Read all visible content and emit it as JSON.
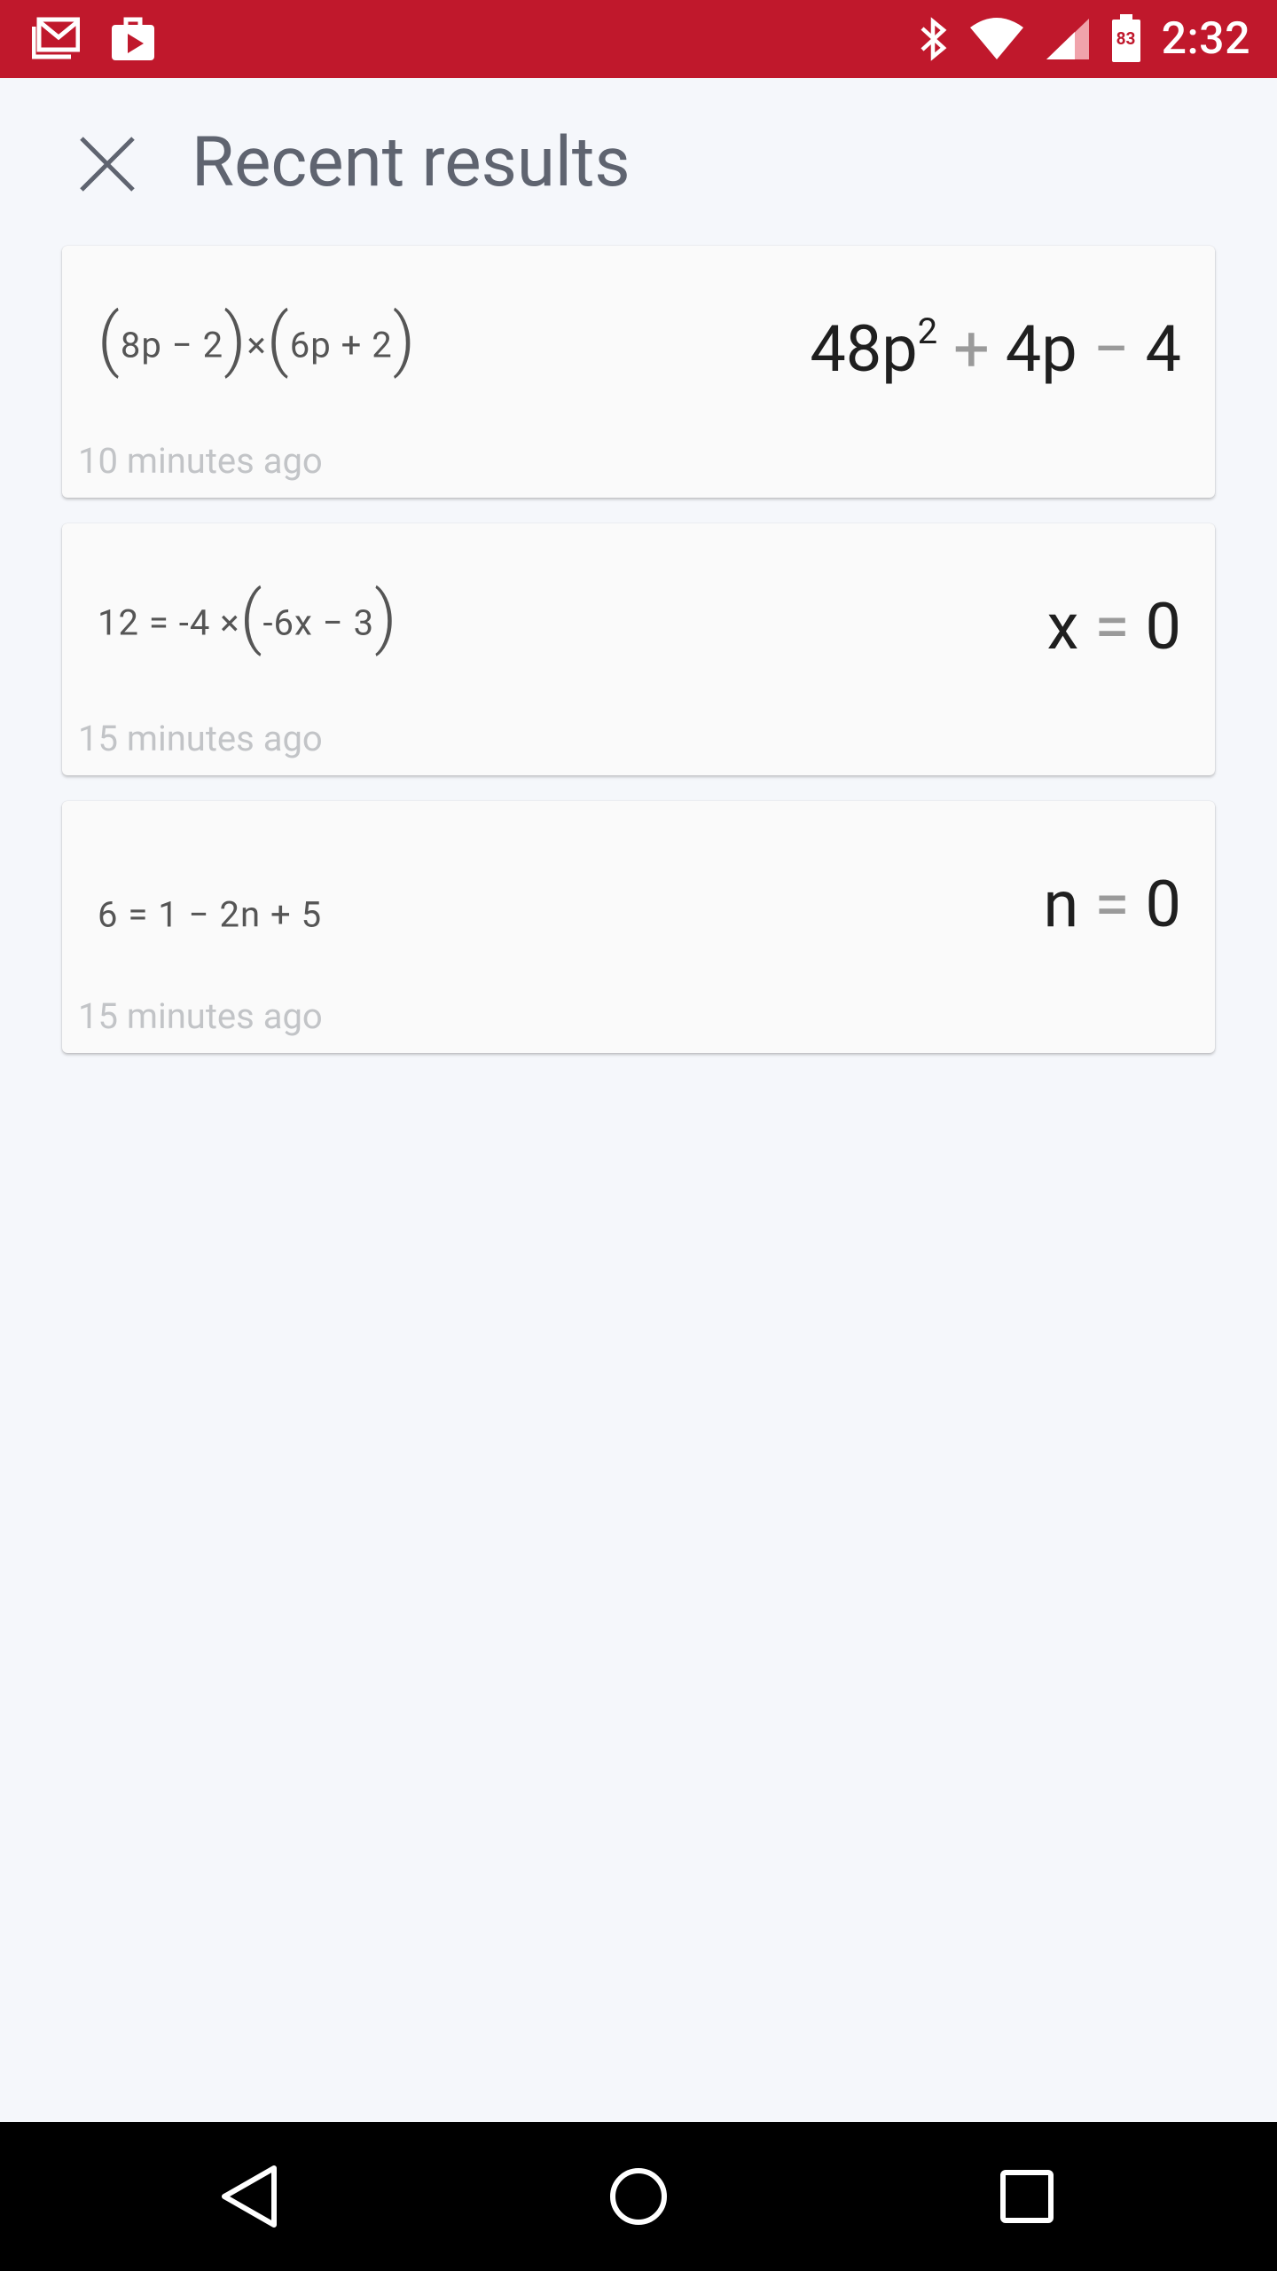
{
  "status_bar": {
    "time": "2:32",
    "battery_level": "83",
    "background_color": "#c0182c"
  },
  "header": {
    "title": "Recent results"
  },
  "results": [
    {
      "expression_parts": [
        "(",
        "8p − 2",
        ")",
        "×",
        "(",
        "6p + 2",
        ")"
      ],
      "answer_parts": [
        "48p",
        "2",
        "+",
        "4p",
        "−",
        "4"
      ],
      "timestamp": "10 minutes ago"
    },
    {
      "expression_parts": [
        "12 = -4 ×",
        "(",
        "-6x − 3",
        ")"
      ],
      "answer_parts": [
        "x",
        "=",
        "0"
      ],
      "timestamp": "15 minutes ago"
    },
    {
      "expression_parts": [
        "6 = 1 − 2n + 5"
      ],
      "answer_parts": [
        "n",
        "=",
        "0"
      ],
      "timestamp": "15 minutes ago"
    }
  ]
}
